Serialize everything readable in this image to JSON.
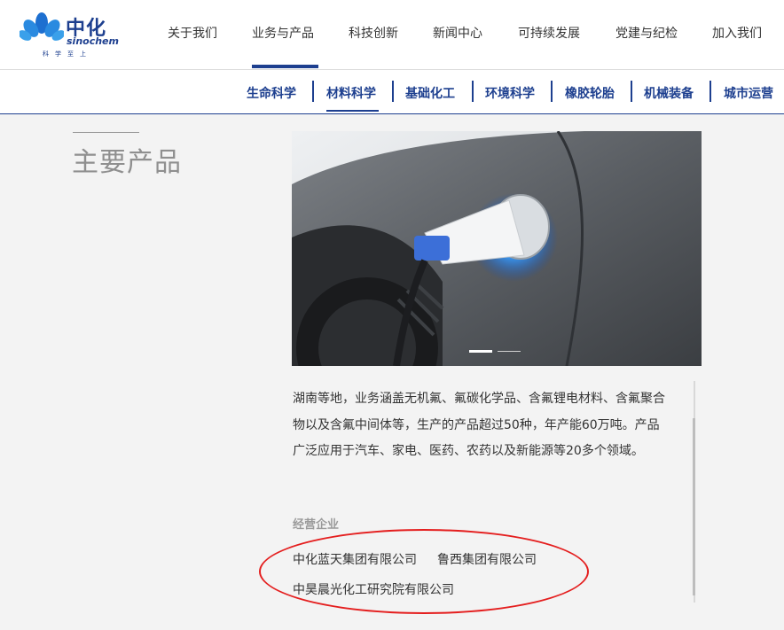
{
  "header": {
    "logo": {
      "cn": "中化",
      "en": "sinochem",
      "slogan": "科学至上",
      "icon": "sinochem-lotus-icon"
    },
    "nav": [
      {
        "label": "关于我们"
      },
      {
        "label": "业务与产品"
      },
      {
        "label": "科技创新"
      },
      {
        "label": "新闻中心"
      },
      {
        "label": "可持续发展"
      },
      {
        "label": "党建与纪检"
      },
      {
        "label": "加入我们"
      }
    ],
    "nav_active": "业务与产品"
  },
  "subnav": {
    "items": [
      {
        "label": "生命科学"
      },
      {
        "label": "材料科学"
      },
      {
        "label": "基础化工"
      },
      {
        "label": "环境科学"
      },
      {
        "label": "橡胶轮胎"
      },
      {
        "label": "机械装备"
      },
      {
        "label": "城市运营"
      }
    ],
    "active": "材料科学"
  },
  "section": {
    "title": "主要产品"
  },
  "hero": {
    "subject": "electric-car-charging-photo",
    "slides_total": 2,
    "slide_active": 1
  },
  "content": {
    "paragraph": "湖南等地，业务涵盖无机氟、氟碳化学品、含氟锂电材料、含氟聚合物以及含氟中间体等，生产的产品超过50种，年产能60万吨。产品广泛应用于汽车、家电、医药、农药以及新能源等20多个领域。",
    "business_label": "经营企业",
    "companies": [
      "中化蓝天集团有限公司",
      "鲁西集团有限公司",
      "中昊晨光化工研究院有限公司"
    ]
  },
  "colors": {
    "brand": "#1d3f8f",
    "annotation": "#e41e1e",
    "page_bg": "#f3f3f3"
  }
}
